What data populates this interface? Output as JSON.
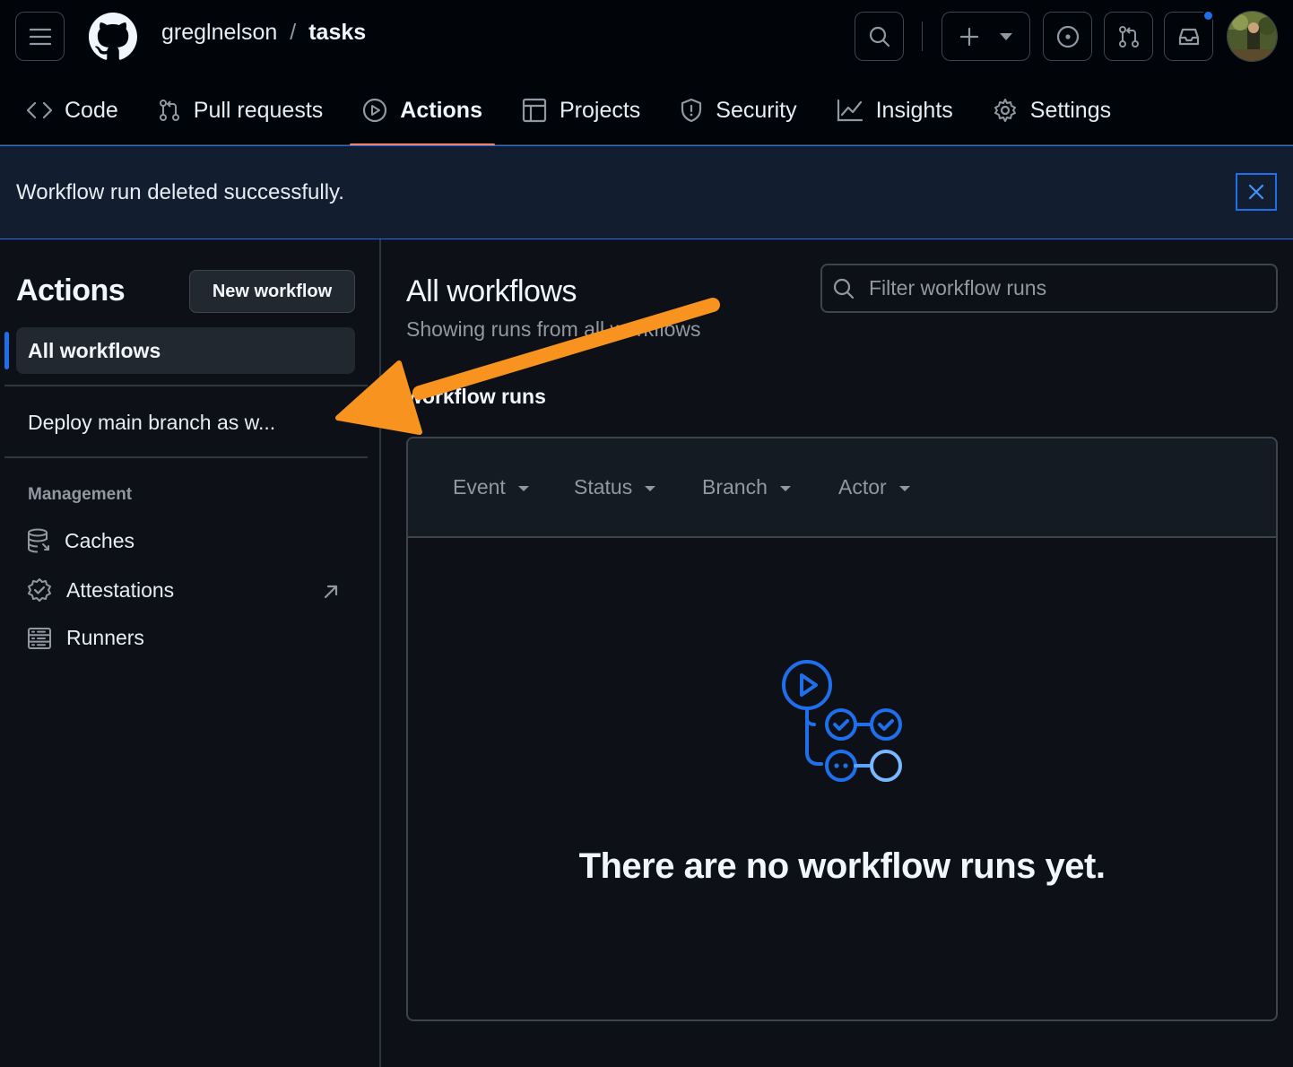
{
  "header": {
    "owner": "greglnelson",
    "separator": "/",
    "repo": "tasks"
  },
  "tabs": [
    {
      "label": "Code",
      "icon": "code-icon"
    },
    {
      "label": "Pull requests",
      "icon": "git-pull-request-icon"
    },
    {
      "label": "Actions",
      "icon": "play-icon",
      "active": true
    },
    {
      "label": "Projects",
      "icon": "table-icon"
    },
    {
      "label": "Security",
      "icon": "shield-icon"
    },
    {
      "label": "Insights",
      "icon": "graph-icon"
    },
    {
      "label": "Settings",
      "icon": "gear-icon"
    }
  ],
  "flash": {
    "message": "Workflow run deleted successfully."
  },
  "sidebar": {
    "title": "Actions",
    "new_workflow_label": "New workflow",
    "all_workflows_label": "All workflows",
    "workflow_item": "Deploy main branch as w...",
    "management_heading": "Management",
    "management_items": [
      {
        "label": "Caches",
        "icon": "database-icon"
      },
      {
        "label": "Attestations",
        "icon": "verified-icon"
      },
      {
        "label": "Runners",
        "icon": "server-icon"
      }
    ]
  },
  "main": {
    "title": "All workflows",
    "subtitle": "Showing runs from all workflows",
    "filter_placeholder": "Filter workflow runs",
    "runs_heading": "workflow runs",
    "filters": [
      "Event",
      "Status",
      "Branch",
      "Actor"
    ],
    "blank_state": "There are no workflow runs yet."
  },
  "colors": {
    "accent": "#1f6feb",
    "tab_underline": "#f78166",
    "annotation_arrow": "#f7931e",
    "header_bg": "#010409",
    "page_bg": "#0d1117",
    "flash_bg": "#121d2f"
  }
}
